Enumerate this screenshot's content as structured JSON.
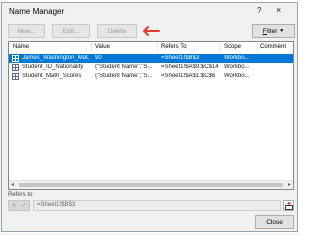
{
  "dialog": {
    "title": "Name Manager",
    "help_glyph": "?",
    "close_glyph": "×"
  },
  "toolbar": {
    "new_label": "New...",
    "edit_label": "Edit...",
    "delete_label": "Delete",
    "filter_label_underlined": "F",
    "filter_label_rest": "ilter",
    "filter_chevron": "▼"
  },
  "annotation": {
    "arrow_color": "#e53935"
  },
  "table": {
    "columns": [
      "Name",
      "Value",
      "Refers To",
      "Scope",
      "Comment"
    ],
    "rows": [
      {
        "name": "James_Washington_Mat...",
        "value": "90",
        "refers_to": "=Sheet1!$B$3",
        "scope": "Workbo...",
        "comment": ""
      },
      {
        "name": "Student_ID_Nationality",
        "value": "{\"Student Name\",\"S...",
        "refers_to": "=Sheet1!$A$9:$C$14",
        "scope": "Workbo...",
        "comment": ""
      },
      {
        "name": "Student_Math_Scores",
        "value": "{\"Student Name\",\"S...",
        "refers_to": "=Sheet1!$A$1:$C$6",
        "scope": "Workbo...",
        "comment": ""
      }
    ],
    "selected_row": 0,
    "selection_color": "#0078d7"
  },
  "scrollbar": {
    "left_arrow": "◂",
    "right_arrow": "▸"
  },
  "refers_to": {
    "label": "Refers to:",
    "cancel_glyph": "✕",
    "enter_glyph": "✓",
    "value": "=Sheet1!$B$3"
  },
  "footer": {
    "close_label": "Close"
  }
}
